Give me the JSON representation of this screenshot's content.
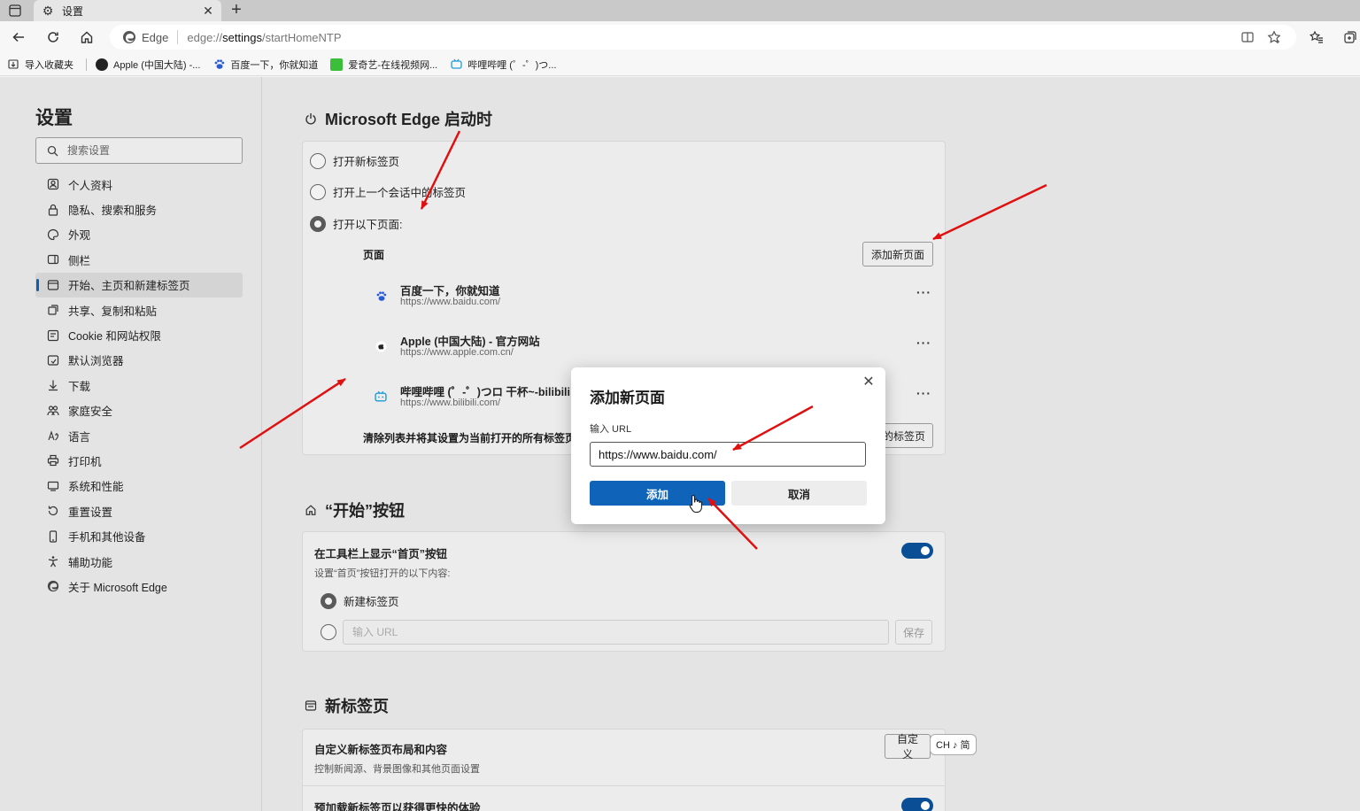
{
  "browser": {
    "tab": {
      "title": "设置",
      "icon": "gear-icon"
    },
    "address": {
      "site_label": "Edge",
      "url_prefix": "edge://",
      "url_host": "settings",
      "url_path": "/startHomeNTP"
    },
    "bookmarks": [
      {
        "label": "导入收藏夹",
        "icon": "import-icon"
      },
      {
        "label": "Apple (中国大陆) -...",
        "icon": "apple-icon"
      },
      {
        "label": "百度一下，你就知道",
        "icon": "baidu-icon"
      },
      {
        "label": "爱奇艺-在线视频网...",
        "icon": "iqiyi-icon"
      },
      {
        "label": "哔哩哔哩 (゜-゜)つ...",
        "icon": "bilibili-icon"
      }
    ]
  },
  "sidebar": {
    "title": "设置",
    "search_placeholder": "搜索设置",
    "items": [
      {
        "label": "个人资料",
        "icon": "profile-icon"
      },
      {
        "label": "隐私、搜索和服务",
        "icon": "lock-icon"
      },
      {
        "label": "外观",
        "icon": "appearance-icon"
      },
      {
        "label": "侧栏",
        "icon": "sidebar-icon"
      },
      {
        "label": "开始、主页和新建标签页",
        "icon": "home-panel-icon",
        "active": true
      },
      {
        "label": "共享、复制和粘贴",
        "icon": "share-icon"
      },
      {
        "label": "Cookie 和网站权限",
        "icon": "cookie-icon"
      },
      {
        "label": "默认浏览器",
        "icon": "browser-icon"
      },
      {
        "label": "下载",
        "icon": "download-icon"
      },
      {
        "label": "家庭安全",
        "icon": "family-icon"
      },
      {
        "label": "语言",
        "icon": "language-icon"
      },
      {
        "label": "打印机",
        "icon": "printer-icon"
      },
      {
        "label": "系统和性能",
        "icon": "system-icon"
      },
      {
        "label": "重置设置",
        "icon": "reset-icon"
      },
      {
        "label": "手机和其他设备",
        "icon": "phone-icon"
      },
      {
        "label": "辅助功能",
        "icon": "accessibility-icon"
      },
      {
        "label": "关于 Microsoft Edge",
        "icon": "edge-icon"
      }
    ]
  },
  "startup": {
    "title": "Microsoft Edge 启动时",
    "options": [
      {
        "label": "打开新标签页",
        "checked": false
      },
      {
        "label": "打开上一个会话中的标签页",
        "checked": false
      },
      {
        "label": "打开以下页面:",
        "checked": true
      }
    ],
    "pages_label": "页面",
    "add_page_button": "添加新页面",
    "pages": [
      {
        "title": "百度一下，你就知道",
        "url": "https://www.baidu.com/",
        "icon": "baidu-icon"
      },
      {
        "title": "Apple (中国大陆) - 官方网站",
        "url": "https://www.apple.com.cn/",
        "icon": "apple-icon"
      },
      {
        "title": "哔哩哔哩 (゜-゜)つロ 干杯~-bilibili",
        "url": "https://www.bilibili.com/",
        "icon": "bilibili-icon"
      }
    ],
    "clear_label": "清除列表并将其设置为当前打开的所有标签页",
    "use_open_tabs_button": "使用所有打开的标签页"
  },
  "home_button": {
    "title": "“开始”按钮",
    "show_label": "在工具栏上显示“首页”按钮",
    "sub_label": "设置“首页”按钮打开的以下内容:",
    "toggle_on": true,
    "option_new_tab": "新建标签页",
    "url_placeholder": "输入 URL",
    "save_button": "保存"
  },
  "new_tab": {
    "title": "新标签页",
    "customize_title": "自定义新标签页布局和内容",
    "customize_sub": "控制新闻源、背景图像和其他页面设置",
    "customize_button": "自定义",
    "preload_title": "预加载新标签页以获得更快的体验",
    "preload_toggle_on": true
  },
  "modal": {
    "title": "添加新页面",
    "label": "输入 URL",
    "value": "https://www.baidu.com/",
    "add_button": "添加",
    "cancel_button": "取消"
  },
  "ime": {
    "label": "CH ♪ 简"
  },
  "colors": {
    "accent": "#0f63b8",
    "toggle": "#0a4f95",
    "annotation_arrow": "#e01010"
  }
}
